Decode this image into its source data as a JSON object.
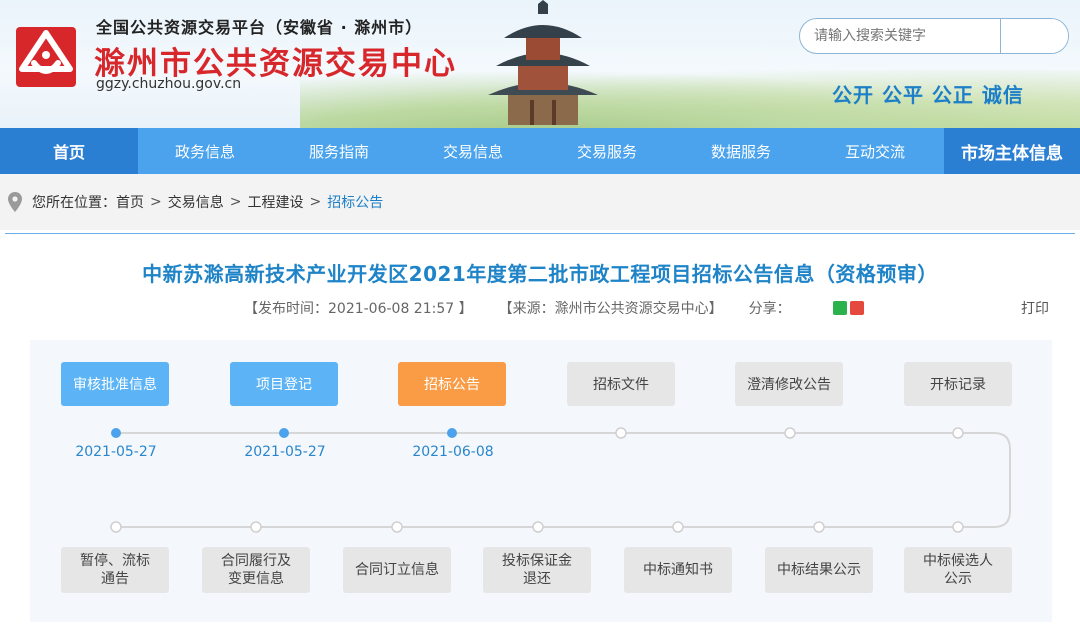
{
  "header": {
    "top_line": "全国公共资源交易平台（安徽省 · 滁州市）",
    "site_name": "滁州市公共资源交易中心",
    "url": "ggzy.chuzhou.gov.cn",
    "search_placeholder": "请输入搜索关键字",
    "slogan": "公开 公平 公正 诚信"
  },
  "nav": {
    "items": [
      "首页",
      "政务信息",
      "服务指南",
      "交易信息",
      "交易服务",
      "数据服务",
      "互动交流"
    ],
    "right_item": "市场主体信息"
  },
  "breadcrumb": {
    "prefix": "您所在位置：",
    "items": [
      "首页",
      "交易信息",
      "工程建设"
    ],
    "current": "招标公告",
    "separator": ">"
  },
  "article": {
    "title": "中新苏滁高新技术产业开发区2021年度第二批市政工程项目招标公告信息（资格预审）",
    "publish": "【发布时间：2021-06-08 21:57 】",
    "source": "【来源：滁州市公共资源交易中心】",
    "share_label": "分享：",
    "print_label": "打印"
  },
  "timeline": {
    "top_stages": [
      {
        "label": "审核批准信息",
        "state": "done",
        "date": "2021-05-27"
      },
      {
        "label": "项目登记",
        "state": "done",
        "date": "2021-05-27"
      },
      {
        "label": "招标公告",
        "state": "current",
        "date": "2021-06-08"
      },
      {
        "label": "招标文件",
        "state": "pending",
        "date": ""
      },
      {
        "label": "澄清修改公告",
        "state": "pending",
        "date": ""
      },
      {
        "label": "开标记录",
        "state": "pending",
        "date": ""
      }
    ],
    "bottom_stages": [
      {
        "line1": "暂停、流标",
        "line2": "通告"
      },
      {
        "line1": "合同履行及",
        "line2": "变更信息"
      },
      {
        "line1": "合同订立信息",
        "line2": ""
      },
      {
        "line1": "投标保证金",
        "line2": "退还"
      },
      {
        "line1": "中标通知书",
        "line2": ""
      },
      {
        "line1": "中标结果公示",
        "line2": ""
      },
      {
        "line1": "中标候选人",
        "line2": "公示"
      }
    ]
  },
  "colors": {
    "nav": "#4aa3ec",
    "nav_active": "#2b7fd2",
    "title": "#1f84c7",
    "brand_red": "#d8272b",
    "done": "#5cb4f6",
    "current": "#fa9c45"
  }
}
